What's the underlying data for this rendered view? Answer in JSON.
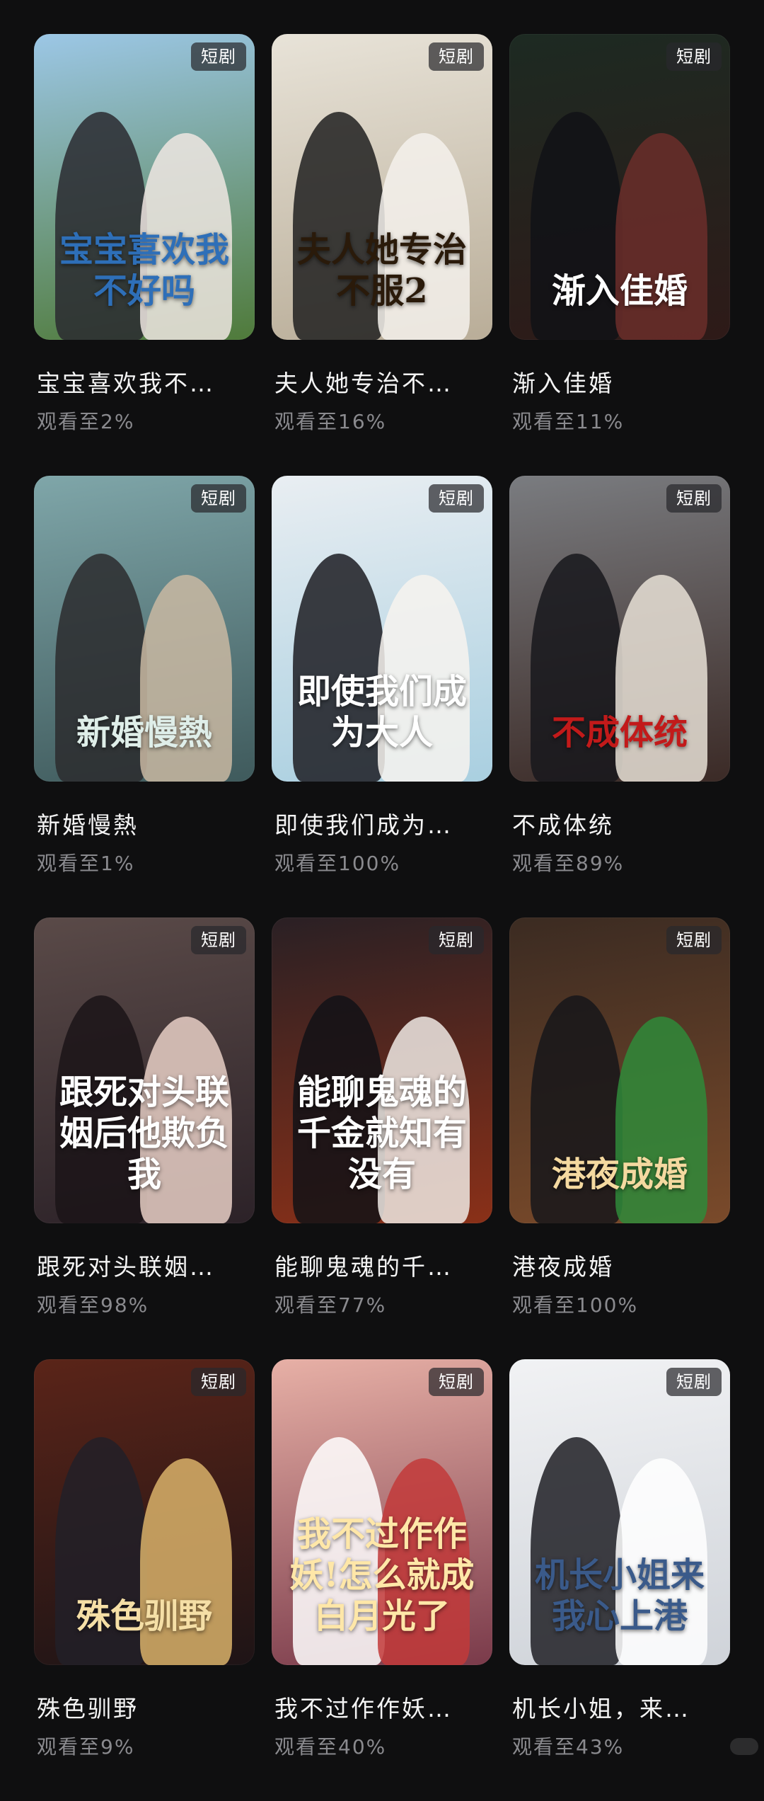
{
  "shows": [
    {
      "title": "宝宝喜欢我不…",
      "progress": "观看至2%",
      "tag": "短剧",
      "poster_text": "宝宝喜欢我不好吗",
      "colors": {
        "bg1": "#9cc7e6",
        "bg2": "#4f7a3a",
        "fig1": "#2a2a30",
        "fig2": "#efe6e2",
        "text": "#2e6fb8"
      }
    },
    {
      "title": "夫人她专治不…",
      "progress": "观看至16%",
      "tag": "短剧",
      "poster_text": "夫人她专治不服2",
      "colors": {
        "bg1": "#e8e3d8",
        "bg2": "#b9ad98",
        "fig1": "#202020",
        "fig2": "#f4f1ec",
        "text": "#2a1a0a"
      }
    },
    {
      "title": "渐入佳婚",
      "progress": "观看至11%",
      "tag": "短剧",
      "poster_text": "渐入佳婚",
      "colors": {
        "bg1": "#1d2a22",
        "bg2": "#2e1a18",
        "fig1": "#111216",
        "fig2": "#6b2e2a",
        "text": "#ffffff"
      }
    },
    {
      "title": "新婚慢熱",
      "progress": "观看至1%",
      "tag": "短剧",
      "poster_text": "新婚慢熱",
      "colors": {
        "bg1": "#7fa6a9",
        "bg2": "#3f5a5c",
        "fig1": "#2b2b2e",
        "fig2": "#c9b9a2",
        "text": "#dfeee9"
      }
    },
    {
      "title": "即使我们成为…",
      "progress": "观看至100%",
      "tag": "短剧",
      "poster_text": "即使我们成为大人",
      "colors": {
        "bg1": "#e9eef2",
        "bg2": "#a9cfe0",
        "fig1": "#1c1c22",
        "fig2": "#f7f3ef",
        "text": "#ffffff"
      }
    },
    {
      "title": "不成体统",
      "progress": "观看至89%",
      "tag": "短剧",
      "poster_text": "不成体统",
      "colors": {
        "bg1": "#7a7c80",
        "bg2": "#3b2a26",
        "fig1": "#18181c",
        "fig2": "#e8e0d6",
        "text": "#c21a1a"
      }
    },
    {
      "title": "跟死对头联姻…",
      "progress": "观看至98%",
      "tag": "短剧",
      "poster_text": "跟死对头联姻后他欺负我",
      "colors": {
        "bg1": "#5a4a48",
        "bg2": "#2c2228",
        "fig1": "#1b1418",
        "fig2": "#e7cfc6",
        "text": "#ffffff"
      }
    },
    {
      "title": "能聊鬼魂的千…",
      "progress": "观看至77%",
      "tag": "短剧",
      "poster_text": "能聊鬼魂的千金就知有没有",
      "colors": {
        "bg1": "#2a2024",
        "bg2": "#8a3018",
        "fig1": "#121216",
        "fig2": "#efe9e4",
        "text": "#ffffff"
      }
    },
    {
      "title": "港夜成婚",
      "progress": "观看至100%",
      "tag": "短剧",
      "poster_text": "港夜成婚",
      "colors": {
        "bg1": "#3b2b22",
        "bg2": "#7a4a2a",
        "fig1": "#16161a",
        "fig2": "#2f8a3a",
        "text": "#f4d9a0"
      }
    },
    {
      "title": "殊色驯野",
      "progress": "观看至9%",
      "tag": "短剧",
      "poster_text": "殊色驯野",
      "colors": {
        "bg1": "#5a2418",
        "bg2": "#1e1416",
        "fig1": "#222028",
        "fig2": "#d9b26a",
        "text": "#f5dfa6"
      }
    },
    {
      "title": "我不过作作妖…",
      "progress": "观看至40%",
      "tag": "短剧",
      "poster_text": "我不过作作妖!怎么就成白月光了",
      "colors": {
        "bg1": "#e7b0a6",
        "bg2": "#7a3a4a",
        "fig1": "#ffffff",
        "fig2": "#c23a3a",
        "text": "#ffe7a8"
      }
    },
    {
      "title": "机长小姐，来…",
      "progress": "观看至43%",
      "tag": "短剧",
      "poster_text": "机长小姐来我心上港",
      "colors": {
        "bg1": "#f1f2f4",
        "bg2": "#cfd3d9",
        "fig1": "#1e1e24",
        "fig2": "#ffffff",
        "text": "#3a5a8a"
      }
    }
  ]
}
